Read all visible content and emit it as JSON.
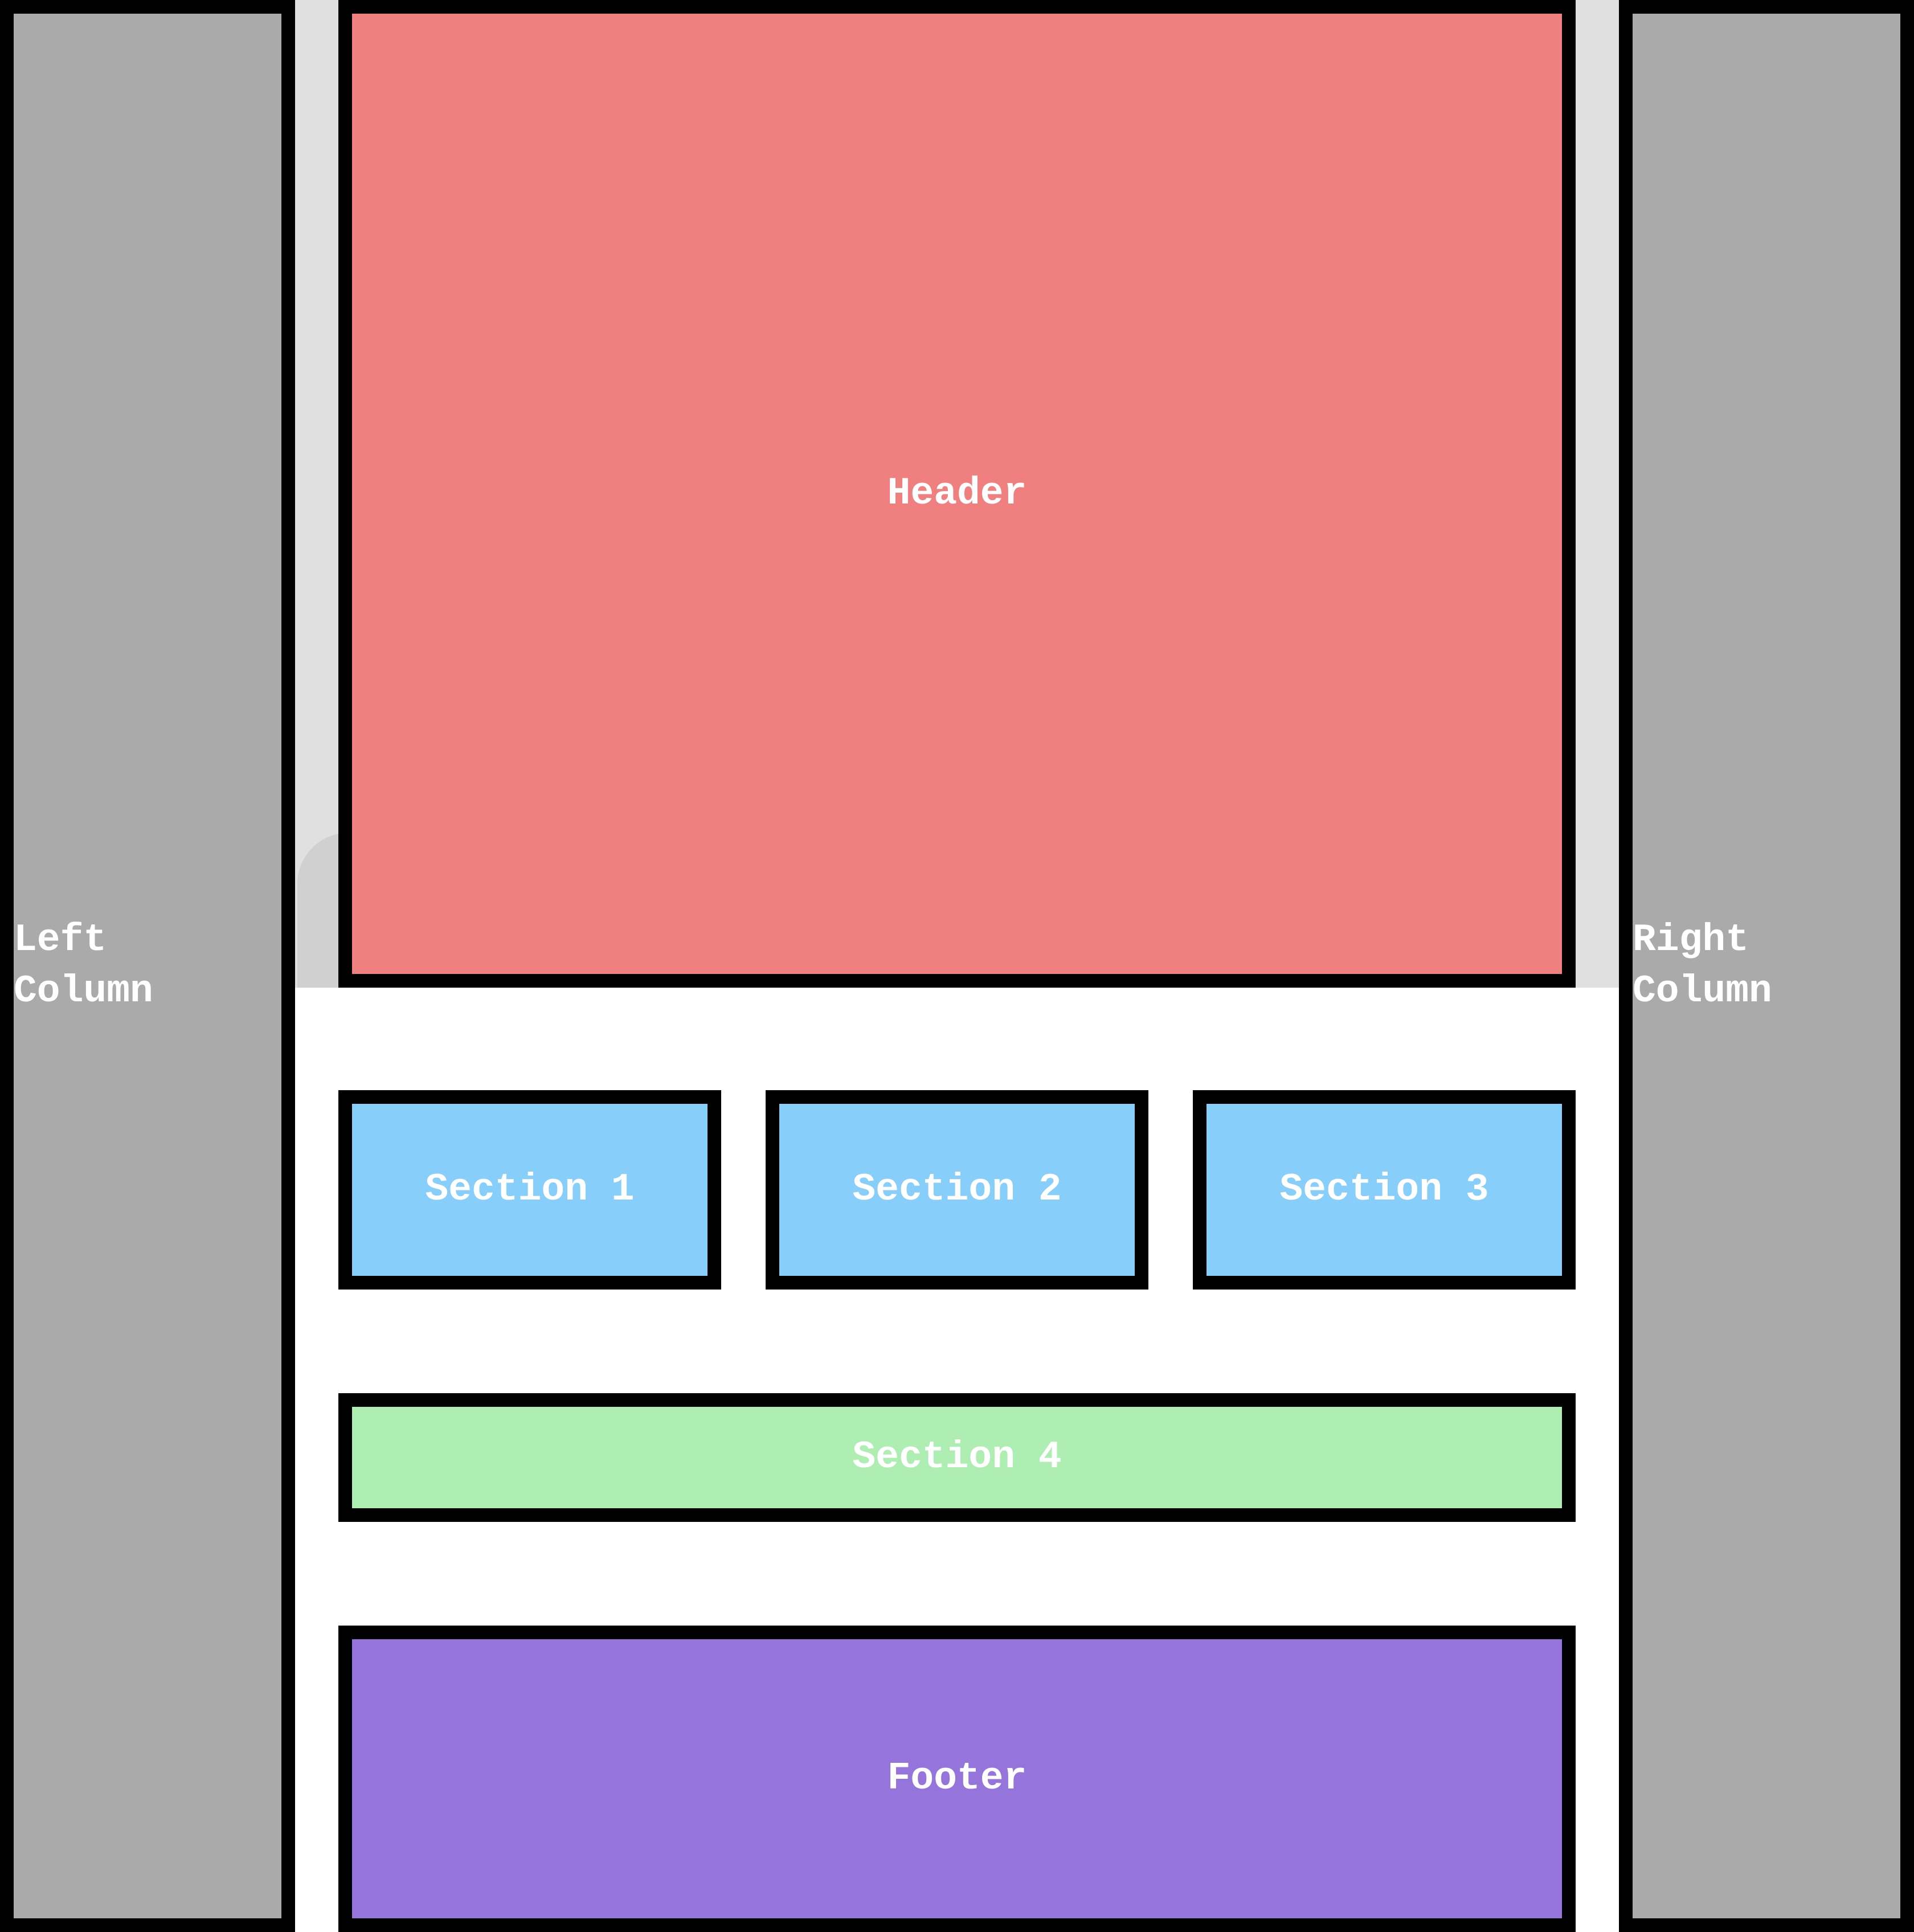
{
  "layout_blocks": {
    "left_column": "Left\nColumn",
    "right_column": "Right\nColumn",
    "header": "Header",
    "section_1": "Section 1",
    "section_2": "Section 2",
    "section_3": "Section 3",
    "section_4": "Section 4",
    "footer": "Footer"
  },
  "colors": {
    "columns": "#aaaaaa",
    "header": "#f08080",
    "sections": "#87cefa",
    "section_4": "#aeeeb2",
    "footer": "#9575dc",
    "header_background": "#e0e0e0",
    "border": "#000000",
    "label": "#ffffff"
  }
}
